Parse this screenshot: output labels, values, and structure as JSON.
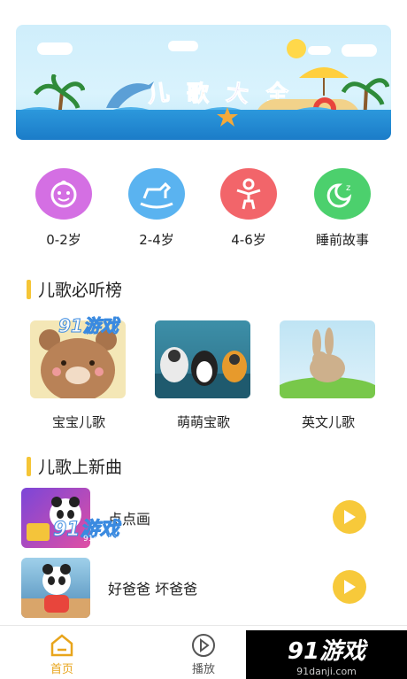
{
  "banner": {
    "title_chars": [
      "儿",
      "歌",
      "大",
      "全"
    ]
  },
  "categories": [
    {
      "label": "0-2岁",
      "icon": "baby-face-icon",
      "color": "#d46fe3"
    },
    {
      "label": "2-4岁",
      "icon": "rocking-horse-icon",
      "color": "#5ab3f0"
    },
    {
      "label": "4-6岁",
      "icon": "child-figure-icon",
      "color": "#f2656a"
    },
    {
      "label": "睡前故事",
      "icon": "moon-sleep-icon",
      "color": "#4cd06d"
    }
  ],
  "section_hot": {
    "title": "儿歌必听榜"
  },
  "hot_list": [
    {
      "label": "宝宝儿歌"
    },
    {
      "label": "萌萌宝歌"
    },
    {
      "label": "英文儿歌"
    }
  ],
  "section_new": {
    "title": "儿歌上新曲"
  },
  "new_songs": [
    {
      "name": "点点画"
    },
    {
      "name": "好爸爸 坏爸爸"
    }
  ],
  "tabs": [
    {
      "label": "首页",
      "active": true,
      "color": "#e8a51c"
    },
    {
      "label": "播放",
      "active": false,
      "color": "#555555"
    }
  ],
  "watermark": {
    "big": "91游戏",
    "small": "91danji.com",
    "overlay": "91游戏",
    "overlay_small": "91danji.com"
  }
}
